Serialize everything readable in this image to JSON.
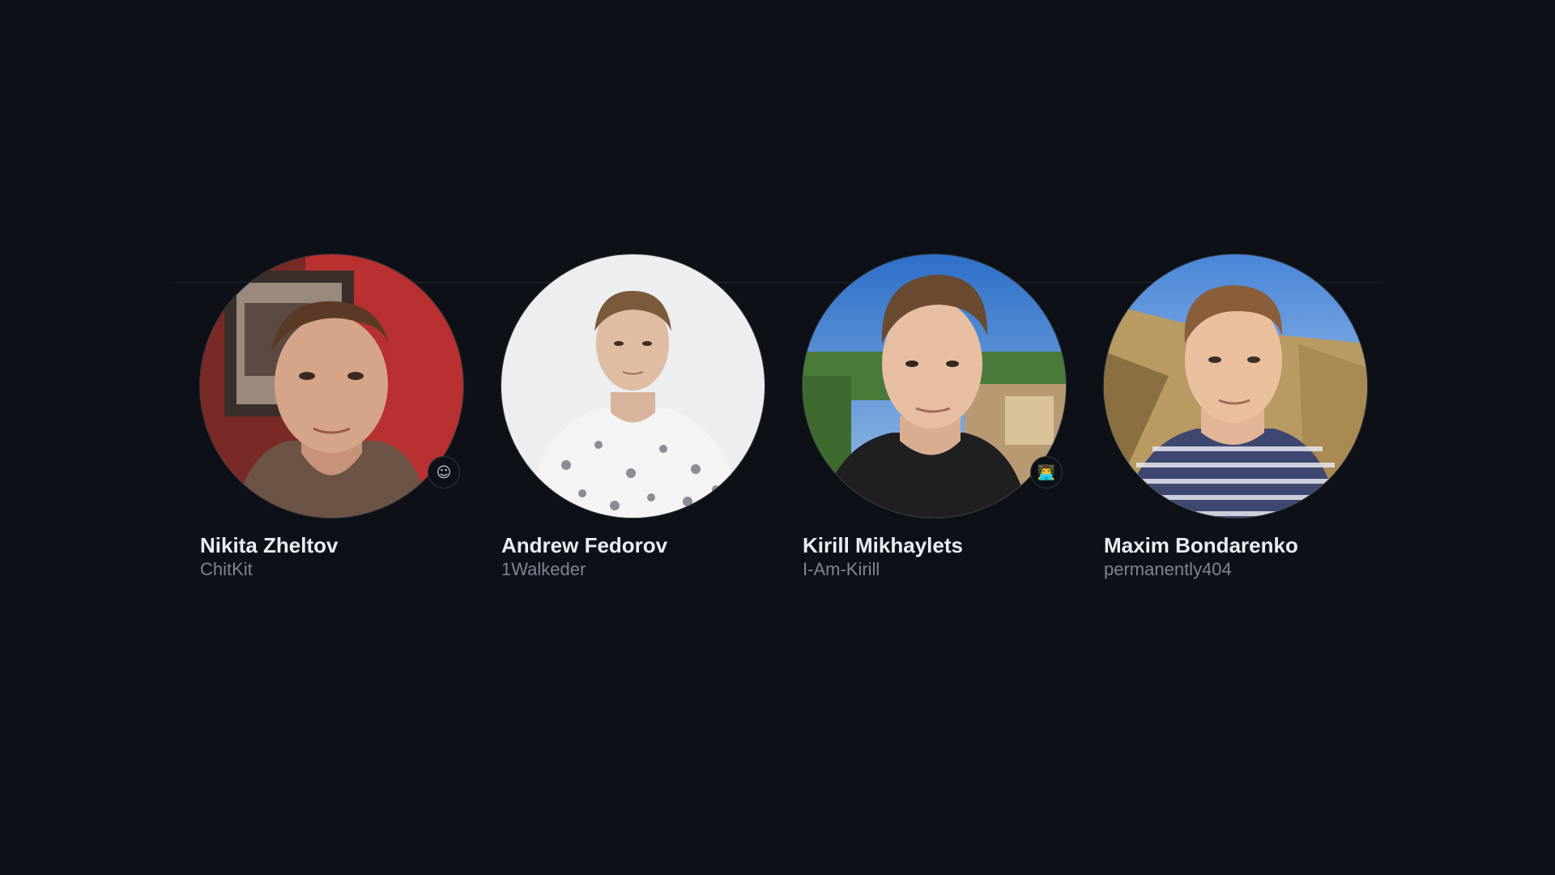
{
  "people": [
    {
      "name": "Nikita Zheltov",
      "login": "ChitKit",
      "status_icon": "smiley-icon",
      "status_glyph": "☺"
    },
    {
      "name": "Andrew Fedorov",
      "login": "1Walkeder"
    },
    {
      "name": "Kirill Mikhaylets",
      "login": "I-Am-Kirill",
      "status_icon": "technologist-icon",
      "status_glyph": "👨‍💻"
    },
    {
      "name": "Maxim Bondarenko",
      "login": "permanently404"
    }
  ],
  "colors": {
    "background": "#0d1117",
    "name_text": "#e6edf3",
    "login_text": "#7d8590",
    "border": "#30363d"
  }
}
